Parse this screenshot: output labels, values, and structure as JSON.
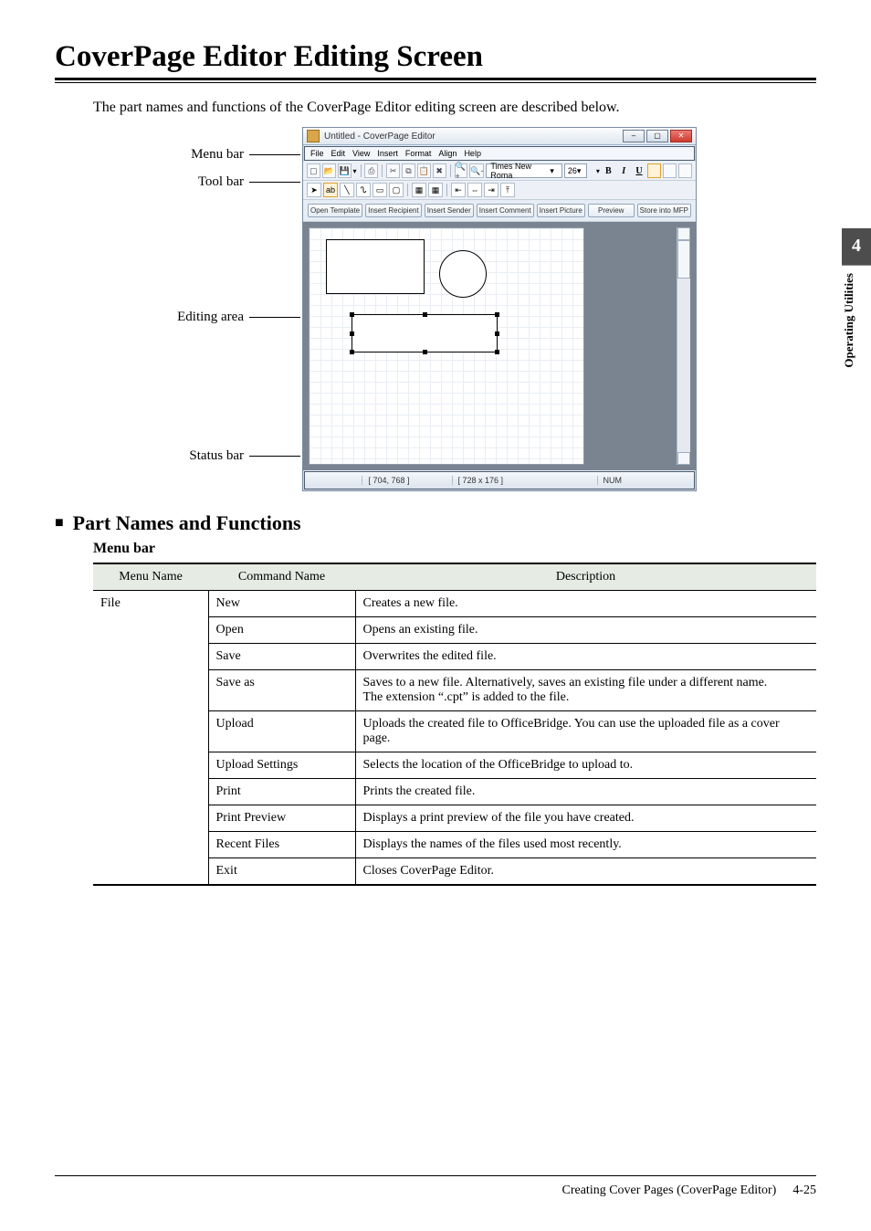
{
  "page_heading": "CoverPage Editor Editing Screen",
  "intro_text": "The part names and functions of the CoverPage Editor editing screen are described below.",
  "diagram_labels": {
    "menu_bar": "Menu bar",
    "tool_bar": "Tool bar",
    "editing_area": "Editing area",
    "status_bar": "Status bar"
  },
  "app_window": {
    "title": "Untitled - CoverPage Editor",
    "menus": [
      "File",
      "Edit",
      "View",
      "Insert",
      "Format",
      "Align",
      "Help"
    ],
    "font_name": "Times New Roma",
    "font_size": "26",
    "format_chars": [
      "B",
      "I",
      "U"
    ],
    "buttons": [
      "Open Template",
      "Insert Recipient",
      "Insert Sender",
      "Insert Comment",
      "Insert Picture",
      "Preview",
      "Store into MFP"
    ],
    "status_center": "[ 704, 768 ]",
    "status_size": "[ 728 x 176 ]",
    "status_num": "NUM"
  },
  "section_heading": "Part Names and Functions",
  "table_title": "Menu bar",
  "table_headers": [
    "Menu Name",
    "Command Name",
    "Description"
  ],
  "file_menu_name": "File",
  "rows": [
    {
      "cmd": "New",
      "desc": "Creates a new file."
    },
    {
      "cmd": "Open",
      "desc": "Opens an existing file."
    },
    {
      "cmd": "Save",
      "desc": "Overwrites the edited file."
    },
    {
      "cmd": "Save as",
      "desc": "Saves to a new file. Alternatively, saves an existing file under a different name.\nThe extension “.cpt” is added to the file."
    },
    {
      "cmd": "Upload",
      "desc": "Uploads the created file to OfficeBridge. You can use the uploaded file as a cover page."
    },
    {
      "cmd": "Upload Settings",
      "desc": "Selects the location of the OfficeBridge to upload to."
    },
    {
      "cmd": "Print",
      "desc": "Prints the created file."
    },
    {
      "cmd": "Print Preview",
      "desc": "Displays a print preview of the file you have created."
    },
    {
      "cmd": "Recent Files",
      "desc": "Displays the names of the files used most recently."
    },
    {
      "cmd": "Exit",
      "desc": "Closes CoverPage Editor."
    }
  ],
  "side_tab": {
    "number": "4",
    "text": "Operating Utilities"
  },
  "footer": {
    "text": "Creating Cover Pages (CoverPage Editor)",
    "page": "4-25"
  }
}
